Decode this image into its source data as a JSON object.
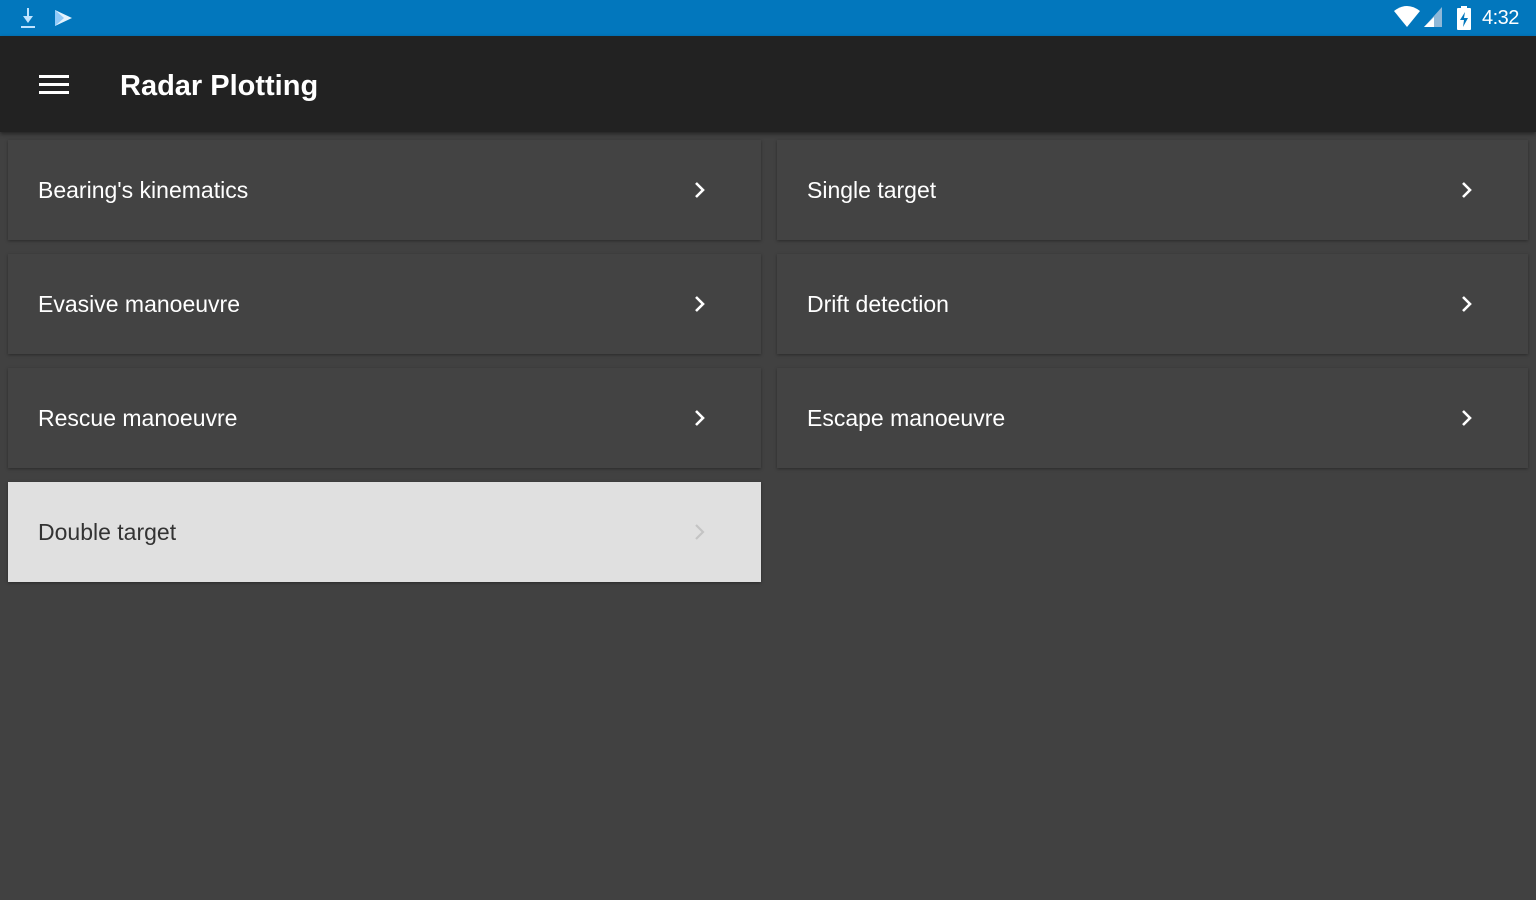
{
  "status_bar": {
    "time": "4:32",
    "left_icons": [
      "download-icon",
      "play-store-icon"
    ],
    "right_icons": [
      "wifi-icon",
      "signal-icon",
      "battery-icon"
    ],
    "color": "#0277bd"
  },
  "app_bar": {
    "title": "Radar Plotting",
    "menu_icon": "hamburger-menu-icon",
    "color": "#222222"
  },
  "menu": {
    "items": [
      {
        "label": "Bearing's kinematics",
        "selected": false
      },
      {
        "label": "Single target",
        "selected": false
      },
      {
        "label": "Evasive manoeuvre",
        "selected": false
      },
      {
        "label": "Drift detection",
        "selected": false
      },
      {
        "label": "Rescue manoeuvre",
        "selected": false
      },
      {
        "label": "Escape manoeuvre",
        "selected": false
      },
      {
        "label": "Double target",
        "selected": true
      }
    ],
    "item_icon": "chevron-right-icon",
    "card_color": "#434343",
    "selected_color": "#e0e0e0",
    "background_color": "#414141"
  }
}
